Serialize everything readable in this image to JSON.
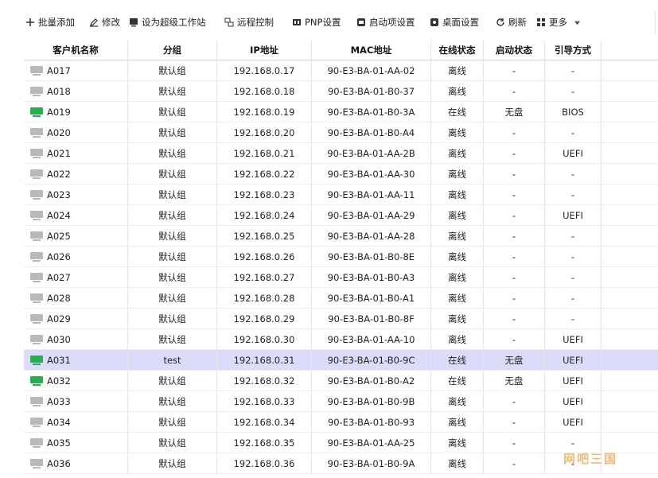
{
  "toolbar": {
    "batch_add": "批量添加",
    "edit": "修改",
    "set_super": "设为超级工作站",
    "remote": "远程控制",
    "pnp": "PNP设置",
    "startup": "启动项设置",
    "desktop": "桌面设置",
    "refresh": "刷新",
    "more": "更多"
  },
  "columns": {
    "name": "客户机名称",
    "group": "分组",
    "ip": "IP地址",
    "mac": "MAC地址",
    "online": "在线状态",
    "boot": "启动状态",
    "guide": "引导方式"
  },
  "colors": {
    "online": "#22b24c",
    "offline": "#b9b9b9",
    "selected_row": "#dcdcfa"
  },
  "rows": [
    {
      "name": "A017",
      "group": "默认组",
      "ip": "192.168.0.17",
      "mac": "90-E3-BA-01-AA-02",
      "online": "离线",
      "boot": "-",
      "guide": "-",
      "on": false
    },
    {
      "name": "A018",
      "group": "默认组",
      "ip": "192.168.0.18",
      "mac": "90-E3-BA-01-B0-37",
      "online": "离线",
      "boot": "-",
      "guide": "-",
      "on": false
    },
    {
      "name": "A019",
      "group": "默认组",
      "ip": "192.168.0.19",
      "mac": "90-E3-BA-01-B0-3A",
      "online": "在线",
      "boot": "无盘",
      "guide": "BIOS",
      "on": true
    },
    {
      "name": "A020",
      "group": "默认组",
      "ip": "192.168.0.20",
      "mac": "90-E3-BA-01-B0-A4",
      "online": "离线",
      "boot": "-",
      "guide": "-",
      "on": false
    },
    {
      "name": "A021",
      "group": "默认组",
      "ip": "192.168.0.21",
      "mac": "90-E3-BA-01-AA-2B",
      "online": "离线",
      "boot": "-",
      "guide": "UEFI",
      "on": false
    },
    {
      "name": "A022",
      "group": "默认组",
      "ip": "192.168.0.22",
      "mac": "90-E3-BA-01-AA-30",
      "online": "离线",
      "boot": "-",
      "guide": "-",
      "on": false
    },
    {
      "name": "A023",
      "group": "默认组",
      "ip": "192.168.0.23",
      "mac": "90-E3-BA-01-AA-11",
      "online": "离线",
      "boot": "-",
      "guide": "-",
      "on": false
    },
    {
      "name": "A024",
      "group": "默认组",
      "ip": "192.168.0.24",
      "mac": "90-E3-BA-01-AA-29",
      "online": "离线",
      "boot": "-",
      "guide": "UEFI",
      "on": false
    },
    {
      "name": "A025",
      "group": "默认组",
      "ip": "192.168.0.25",
      "mac": "90-E3-BA-01-AA-28",
      "online": "离线",
      "boot": "-",
      "guide": "-",
      "on": false
    },
    {
      "name": "A026",
      "group": "默认组",
      "ip": "192.168.0.26",
      "mac": "90-E3-BA-01-B0-8E",
      "online": "离线",
      "boot": "-",
      "guide": "-",
      "on": false
    },
    {
      "name": "A027",
      "group": "默认组",
      "ip": "192.168.0.27",
      "mac": "90-E3-BA-01-B0-A3",
      "online": "离线",
      "boot": "-",
      "guide": "-",
      "on": false
    },
    {
      "name": "A028",
      "group": "默认组",
      "ip": "192.168.0.28",
      "mac": "90-E3-BA-01-B0-A1",
      "online": "离线",
      "boot": "-",
      "guide": "-",
      "on": false
    },
    {
      "name": "A029",
      "group": "默认组",
      "ip": "192.168.0.29",
      "mac": "90-E3-BA-01-B0-8F",
      "online": "离线",
      "boot": "-",
      "guide": "-",
      "on": false
    },
    {
      "name": "A030",
      "group": "默认组",
      "ip": "192.168.0.30",
      "mac": "90-E3-BA-01-AA-10",
      "online": "离线",
      "boot": "-",
      "guide": "UEFI",
      "on": false
    },
    {
      "name": "A031",
      "group": "test",
      "ip": "192.168.0.31",
      "mac": "90-E3-BA-01-B0-9C",
      "online": "在线",
      "boot": "无盘",
      "guide": "UEFI",
      "on": true,
      "selected": true
    },
    {
      "name": "A032",
      "group": "默认组",
      "ip": "192.168.0.32",
      "mac": "90-E3-BA-01-B0-A2",
      "online": "在线",
      "boot": "无盘",
      "guide": "UEFI",
      "on": true
    },
    {
      "name": "A033",
      "group": "默认组",
      "ip": "192.168.0.33",
      "mac": "90-E3-BA-01-B0-9B",
      "online": "离线",
      "boot": "-",
      "guide": "UEFI",
      "on": false
    },
    {
      "name": "A034",
      "group": "默认组",
      "ip": "192.168.0.34",
      "mac": "90-E3-BA-01-B0-93",
      "online": "离线",
      "boot": "-",
      "guide": "UEFI",
      "on": false
    },
    {
      "name": "A035",
      "group": "默认组",
      "ip": "192.168.0.35",
      "mac": "90-E3-BA-01-AA-25",
      "online": "离线",
      "boot": "-",
      "guide": "-",
      "on": false
    },
    {
      "name": "A036",
      "group": "默认组",
      "ip": "192.168.0.36",
      "mac": "90-E3-BA-01-B0-9A",
      "online": "离线",
      "boot": "-",
      "guide": "-",
      "on": false
    }
  ],
  "watermark": "网吧三国"
}
